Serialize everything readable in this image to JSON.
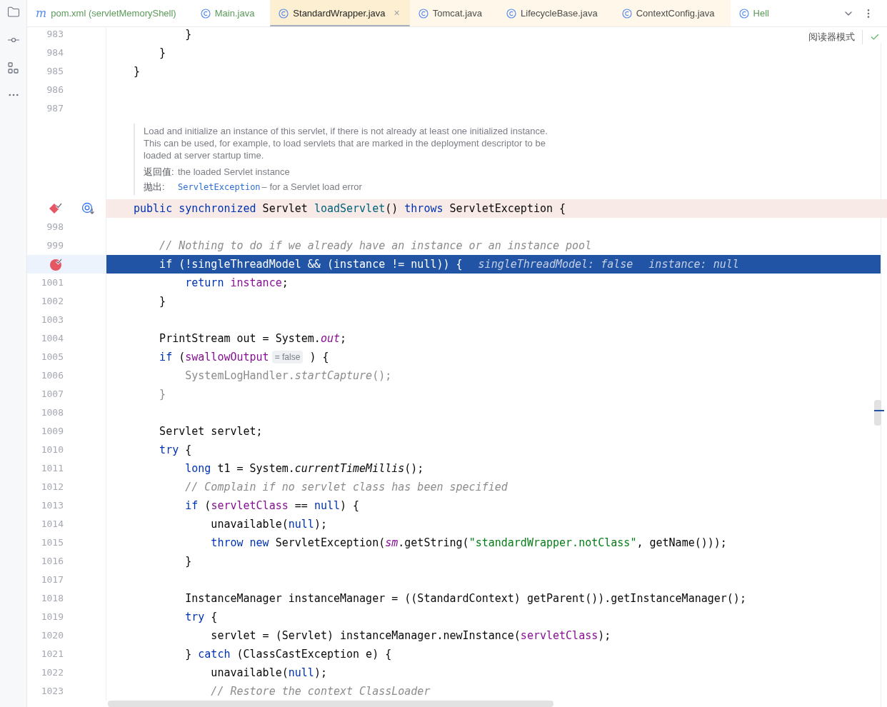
{
  "tabs": [
    {
      "badge": "m",
      "label": "pom.xml (servletMemoryShell)",
      "color": "#5a9a5a",
      "selected": false,
      "library": false
    },
    {
      "label": "Main.java",
      "color": "#5a9a5a",
      "selected": false,
      "library": false
    },
    {
      "label": "StandardWrapper.java",
      "color": "#1f1f1f",
      "selected": true,
      "library": true,
      "close": "×"
    },
    {
      "label": "Tomcat.java",
      "color": "#4c4c4c",
      "selected": false,
      "library": true
    },
    {
      "label": "LifecycleBase.java",
      "color": "#4c4c4c",
      "selected": false,
      "library": true
    },
    {
      "label": "ContextConfig.java",
      "color": "#4c4c4c",
      "selected": false,
      "library": true
    },
    {
      "label": "Hell",
      "color": "#5a9a5a",
      "selected": false,
      "library": false
    }
  ],
  "reader_mode": "阅读器模式",
  "lines": [
    {
      "kind": "code",
      "number": "983",
      "tokens": [
        {
          "kind": "plain",
          "t": "        }"
        }
      ]
    },
    {
      "kind": "code",
      "number": "984",
      "tokens": [
        {
          "kind": "plain",
          "t": "    }"
        }
      ]
    },
    {
      "kind": "code",
      "number": "985",
      "tokens": [
        {
          "kind": "plain",
          "t": "}"
        }
      ]
    },
    {
      "kind": "code",
      "number": "986"
    },
    {
      "kind": "code",
      "number": "987"
    },
    {
      "kind": "doc",
      "paragraph": "Load and initialize an instance of this servlet, if there is not already at least one initialized instance. This can be used, for example, to load servlets that are marked in the deployment descriptor to be loaded at server startup time.",
      "returns_label": "返回值:",
      "returns": "the loaded Servlet instance",
      "throws_label": "抛出:",
      "throws_link": "ServletException",
      "throws_text": "– for a Servlet load error"
    },
    {
      "kind": "method_breakpoint",
      "tokens": [
        {
          "kind": "kw",
          "t": "public synchronized"
        },
        {
          "kind": "plain",
          "t": " Servlet "
        },
        {
          "kind": "decl",
          "t": "loadServlet"
        },
        {
          "kind": "plain",
          "t": "() "
        },
        {
          "kind": "kw",
          "t": "throws"
        },
        {
          "kind": "plain",
          "t": " ServletException {"
        }
      ]
    },
    {
      "kind": "code",
      "number": "998"
    },
    {
      "kind": "code",
      "number": "999",
      "tokens": [
        {
          "kind": "comment",
          "t": "    // Nothing to do if we already have an instance or an instance pool"
        }
      ]
    },
    {
      "kind": "execution_point",
      "tokens": [
        {
          "kind": "plain",
          "t": "    if (!singleThreadModel && (instance != null)) {"
        },
        {
          "kind": "debug_hint",
          "t": "singleThreadModel: false"
        },
        {
          "kind": "debug_hint",
          "t": "instance: null"
        }
      ]
    },
    {
      "kind": "code",
      "number": "1001",
      "tokens": [
        {
          "kind": "kw",
          "t": "        return"
        },
        {
          "kind": "field",
          "t": " instance"
        },
        {
          "kind": "plain",
          "t": ";"
        }
      ]
    },
    {
      "kind": "code",
      "number": "1002",
      "tokens": [
        {
          "kind": "plain",
          "t": "    }"
        }
      ]
    },
    {
      "kind": "code",
      "number": "1003"
    },
    {
      "kind": "code",
      "number": "1004",
      "tokens": [
        {
          "kind": "plain",
          "t": "    PrintStream out = System."
        },
        {
          "kind": "static_field",
          "t": "out"
        },
        {
          "kind": "plain",
          "t": ";"
        }
      ]
    },
    {
      "kind": "code",
      "number": "1005",
      "tokens": [
        {
          "kind": "kw",
          "t": "    if"
        },
        {
          "kind": "plain",
          "t": " ("
        },
        {
          "kind": "field",
          "t": "swallowOutput"
        },
        {
          "kind": "inline_value",
          "t": "= false"
        },
        {
          "kind": "plain",
          "t": " ) {"
        }
      ]
    },
    {
      "kind": "code",
      "number": "1006",
      "tokens": [
        {
          "kind": "dim",
          "t": "        SystemLogHandler."
        },
        {
          "kind": "dim_italic",
          "t": "startCapture"
        },
        {
          "kind": "dim",
          "t": "();"
        }
      ]
    },
    {
      "kind": "code",
      "number": "1007",
      "tokens": [
        {
          "kind": "dim",
          "t": "    }"
        }
      ]
    },
    {
      "kind": "code",
      "number": "1008"
    },
    {
      "kind": "code",
      "number": "1009",
      "tokens": [
        {
          "kind": "plain",
          "t": "    Servlet servlet;"
        }
      ]
    },
    {
      "kind": "code",
      "number": "1010",
      "tokens": [
        {
          "kind": "kw",
          "t": "    try"
        },
        {
          "kind": "plain",
          "t": " {"
        }
      ]
    },
    {
      "kind": "code",
      "number": "1011",
      "tokens": [
        {
          "kind": "kw",
          "t": "        long"
        },
        {
          "kind": "plain",
          "t": " t1 = System."
        },
        {
          "kind": "static_method",
          "t": "currentTimeMillis"
        },
        {
          "kind": "plain",
          "t": "();"
        }
      ]
    },
    {
      "kind": "code",
      "number": "1012",
      "tokens": [
        {
          "kind": "comment",
          "t": "        // Complain if no servlet class has been specified"
        }
      ]
    },
    {
      "kind": "code",
      "number": "1013",
      "tokens": [
        {
          "kind": "kw",
          "t": "        if"
        },
        {
          "kind": "plain",
          "t": " ("
        },
        {
          "kind": "field",
          "t": "servletClass"
        },
        {
          "kind": "plain",
          "t": " == "
        },
        {
          "kind": "kw",
          "t": "null"
        },
        {
          "kind": "plain",
          "t": ") {"
        }
      ]
    },
    {
      "kind": "code",
      "number": "1014",
      "tokens": [
        {
          "kind": "plain",
          "t": "            unavailable("
        },
        {
          "kind": "kw",
          "t": "null"
        },
        {
          "kind": "plain",
          "t": ");"
        }
      ]
    },
    {
      "kind": "code",
      "number": "1015",
      "tokens": [
        {
          "kind": "kw",
          "t": "            throw new"
        },
        {
          "kind": "plain",
          "t": " ServletException("
        },
        {
          "kind": "static_field",
          "t": "sm"
        },
        {
          "kind": "plain",
          "t": ".getString("
        },
        {
          "kind": "str",
          "t": "\"standardWrapper.notClass\""
        },
        {
          "kind": "plain",
          "t": ", getName()));"
        }
      ]
    },
    {
      "kind": "code",
      "number": "1016",
      "tokens": [
        {
          "kind": "plain",
          "t": "        }"
        }
      ]
    },
    {
      "kind": "code",
      "number": "1017"
    },
    {
      "kind": "code",
      "number": "1018",
      "tokens": [
        {
          "kind": "plain",
          "t": "        InstanceManager instanceManager = ((StandardContext) getParent()).getInstanceManager();"
        }
      ]
    },
    {
      "kind": "code",
      "number": "1019",
      "tokens": [
        {
          "kind": "kw",
          "t": "        try"
        },
        {
          "kind": "plain",
          "t": " {"
        }
      ]
    },
    {
      "kind": "code",
      "number": "1020",
      "tokens": [
        {
          "kind": "plain",
          "t": "            servlet = (Servlet) instanceManager.newInstance("
        },
        {
          "kind": "field",
          "t": "servletClass"
        },
        {
          "kind": "plain",
          "t": ");"
        }
      ]
    },
    {
      "kind": "code",
      "number": "1021",
      "tokens": [
        {
          "kind": "plain",
          "t": "        } "
        },
        {
          "kind": "kw",
          "t": "catch"
        },
        {
          "kind": "plain",
          "t": " (ClassCastException e) {"
        }
      ]
    },
    {
      "kind": "code",
      "number": "1022",
      "tokens": [
        {
          "kind": "plain",
          "t": "            unavailable("
        },
        {
          "kind": "kw",
          "t": "null"
        },
        {
          "kind": "plain",
          "t": ");"
        }
      ]
    },
    {
      "kind": "code",
      "number": "1023",
      "tokens": [
        {
          "kind": "comment",
          "t": "            // Restore the context ClassLoader"
        }
      ]
    }
  ]
}
